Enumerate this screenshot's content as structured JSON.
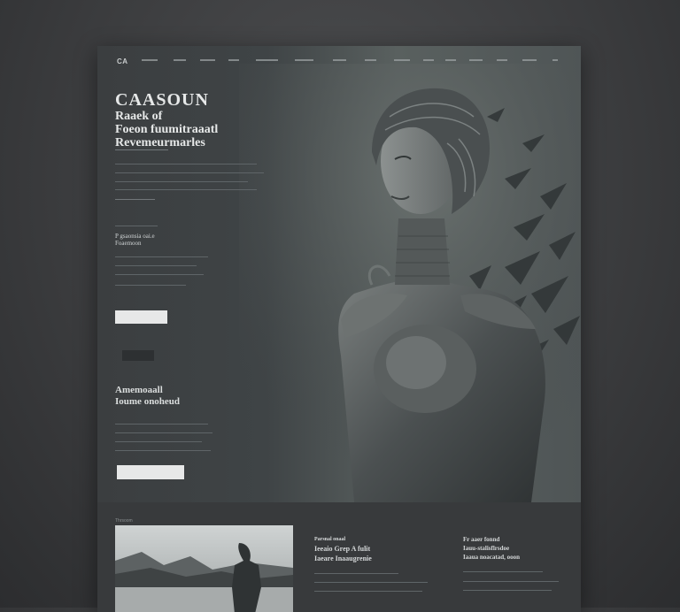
{
  "nav": {
    "logo": "CA",
    "items": [
      "",
      "",
      "",
      "",
      "",
      "",
      "",
      "",
      "",
      "",
      "",
      "",
      ""
    ]
  },
  "hero": {
    "title_line1": "CAASOUN",
    "title_line2": "Raaek of",
    "title_line3": "Foeon fuumitraaatl",
    "title_line4": "Revemeurmarles",
    "subheading": "P gsaonsia oai.e",
    "subheading_line2": "Foaemoon",
    "button_primary": "",
    "button_secondary": "",
    "section_title_line1": "Amemoaall",
    "section_title_line2": "Ioume onoheud",
    "button_bottom": ""
  },
  "bottom": {
    "label": "Thrsoom",
    "card1_line1": "Parsnal onaal",
    "card1_line2": "Ieeaio Grep A fulit",
    "card1_line3": "Iaeare Inaaugrenie",
    "card2_line1": "Fr aaer fonnd",
    "card2_line2": "Iauu-stalisflrsdoe",
    "card2_line3": "Iaaua noacatad, ooon"
  },
  "colors": {
    "page_bg": "#3a3b3d",
    "panel": "#3b3d3f",
    "button_light": "#e7e8e8",
    "button_dark": "#2d3032"
  }
}
